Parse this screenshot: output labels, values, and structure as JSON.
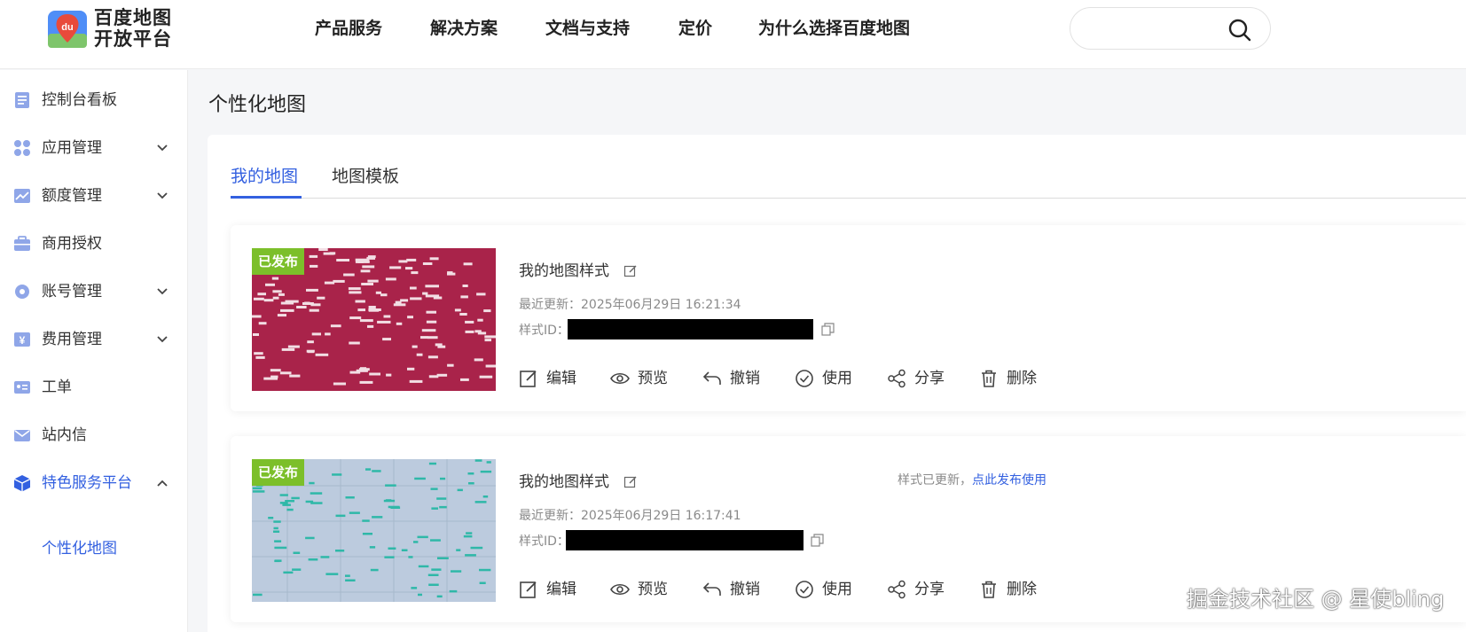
{
  "logo": {
    "line1": "百度地图",
    "line2": "开放平台",
    "badge": "du"
  },
  "nav": {
    "items": [
      "产品服务",
      "解决方案",
      "文档与支持",
      "定价",
      "为什么选择百度地图"
    ]
  },
  "search": {
    "placeholder": ""
  },
  "sidebar": {
    "items": [
      {
        "label": "控制台看板",
        "icon": "dashboard-icon"
      },
      {
        "label": "应用管理",
        "icon": "apps-icon"
      },
      {
        "label": "额度管理",
        "icon": "quota-chart-icon"
      },
      {
        "label": "商用授权",
        "icon": "briefcase-icon"
      },
      {
        "label": "账号管理",
        "icon": "gear-icon"
      },
      {
        "label": "费用管理",
        "icon": "yuan-icon"
      },
      {
        "label": "工单",
        "icon": "ticket-icon"
      },
      {
        "label": "站内信",
        "icon": "mail-icon"
      },
      {
        "label": "特色服务平台",
        "icon": "cube-icon"
      }
    ],
    "sub_item": "个性化地图"
  },
  "page": {
    "title": "个性化地图"
  },
  "tabs": [
    "我的地图",
    "地图模板"
  ],
  "cards": [
    {
      "badge": "已发布",
      "title": "我的地图样式",
      "updated": "最近更新：2025年06月29日 16:21:34",
      "style_id_label": "样式ID：",
      "notice": "",
      "notice_link": "",
      "thumb_color": "#a9234a",
      "actions": [
        "编辑",
        "预览",
        "撤销",
        "使用",
        "分享",
        "删除"
      ]
    },
    {
      "badge": "已发布",
      "title": "我的地图样式",
      "updated": "最近更新：2025年06月29日 16:17:41",
      "style_id_label": "样式ID：",
      "notice": "样式已更新，",
      "notice_link": "点此发布使用",
      "thumb_color": "#bccbde",
      "actions": [
        "编辑",
        "预览",
        "撤销",
        "使用",
        "分享",
        "删除"
      ]
    }
  ],
  "watermark": "掘金技术社区 @ 星使bling",
  "colors": {
    "accent": "#3360e0",
    "badge": "#7cbf2a"
  }
}
